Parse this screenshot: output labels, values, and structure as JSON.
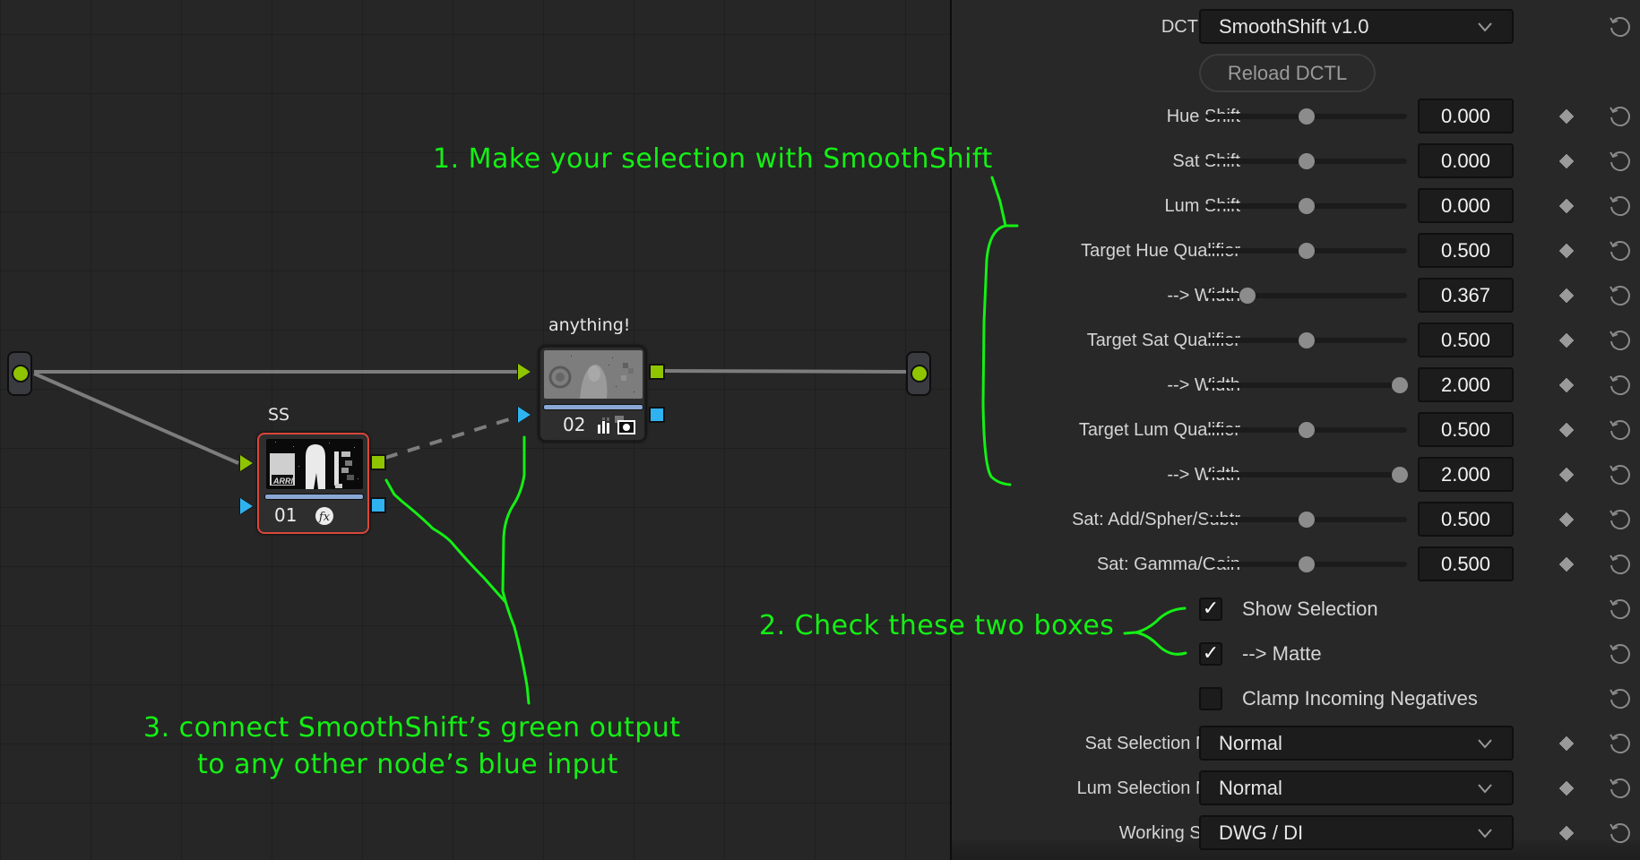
{
  "node_editor": {
    "nodes": [
      {
        "id": "01",
        "label": "SS",
        "number": "01",
        "selected": true,
        "badge_icons": [
          "fx-icon"
        ]
      },
      {
        "id": "02",
        "label": "anything!",
        "number": "02",
        "selected": false,
        "badge_icons": [
          "bars-icon",
          "matte-icon"
        ]
      }
    ],
    "connections": [
      {
        "from": "input",
        "to": "02",
        "type": "solid"
      },
      {
        "from": "input",
        "to": "01",
        "type": "solid"
      },
      {
        "from": "01",
        "to": "02-key-input",
        "type": "dashed"
      },
      {
        "from": "02",
        "to": "output",
        "type": "solid"
      }
    ]
  },
  "annotations": {
    "step1": "1. Make your selection with SmoothShift",
    "step2": "2. Check these two boxes",
    "step3_line1": "3. connect SmoothShift’s green output",
    "step3_line2": "to any other node’s blue input",
    "color": "#14f014"
  },
  "panel": {
    "dctl_list": {
      "label": "DCTL List",
      "value": "SmoothShift v1.0"
    },
    "reload_button": "Reload DCTL",
    "sliders": [
      {
        "label": "Hue Shift",
        "value": "0.000",
        "position": 0.5
      },
      {
        "label": "Sat Shift",
        "value": "0.000",
        "position": 0.5
      },
      {
        "label": "Lum Shift",
        "value": "0.000",
        "position": 0.5
      },
      {
        "label": "Target Hue Qualifier",
        "value": "0.500",
        "position": 0.5
      },
      {
        "label": "--> Width",
        "value": "0.367",
        "position": 0.183
      },
      {
        "label": "Target Sat Qualifier",
        "value": "0.500",
        "position": 0.5
      },
      {
        "label": "--> Width",
        "value": "2.000",
        "position": 1.0
      },
      {
        "label": "Target Lum Qualifier",
        "value": "0.500",
        "position": 0.5
      },
      {
        "label": "--> Width",
        "value": "2.000",
        "position": 1.0
      },
      {
        "label": "Sat: Add/Spher/Subtr",
        "value": "0.500",
        "position": 0.5
      },
      {
        "label": "Sat: Gamma/Gain",
        "value": "0.500",
        "position": 0.5
      }
    ],
    "checkboxes": [
      {
        "label": "Show Selection",
        "checked": true
      },
      {
        "label": "--> Matte",
        "checked": true
      },
      {
        "label": "Clamp Incoming Negatives",
        "checked": false
      }
    ],
    "dropdowns": [
      {
        "label": "Sat Selection Mode",
        "value": "Normal"
      },
      {
        "label": "Lum Selection Mode",
        "value": "Normal"
      },
      {
        "label": "Working Space",
        "value": "DWG / DI"
      }
    ],
    "check_glyph": "✓"
  }
}
